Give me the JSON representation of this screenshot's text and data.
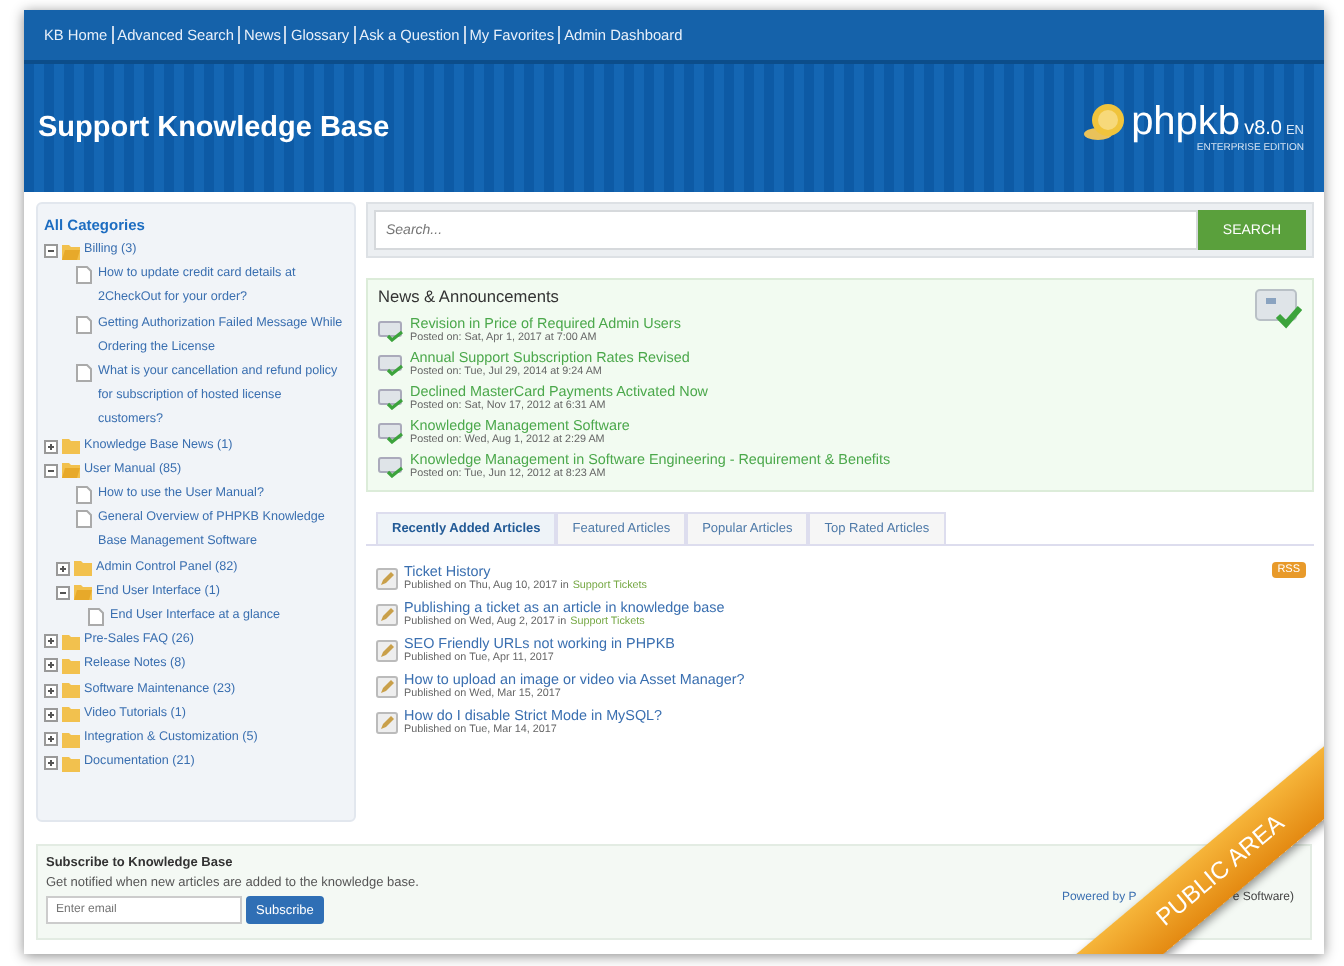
{
  "top_nav": [
    "KB Home",
    "Advanced Search",
    "News",
    "Glossary",
    "Ask a Question",
    "My Favorites",
    "Admin Dashboard"
  ],
  "header": {
    "title": "Support Knowledge Base",
    "logo": "phpkb",
    "version": "v8.0",
    "lang": "EN",
    "edition": "ENTERPRISE EDITION"
  },
  "sidebar": {
    "heading": "All Categories",
    "tree": [
      {
        "kind": "folder",
        "label": "Billing (3)",
        "expanded": true,
        "children": [
          {
            "kind": "article",
            "label": "How to update credit card details at 2CheckOut for your order?"
          },
          {
            "kind": "article",
            "label": "Getting Authorization Failed Message While Ordering the License"
          },
          {
            "kind": "article",
            "label": "What is your cancellation and refund policy for subscription of hosted license customers?"
          }
        ]
      },
      {
        "kind": "folder",
        "label": "Knowledge Base News (1)",
        "expanded": false
      },
      {
        "kind": "folder",
        "label": "User Manual (85)",
        "expanded": true,
        "children": [
          {
            "kind": "article",
            "label": "How to use the User Manual?"
          },
          {
            "kind": "article",
            "label": "General Overview of PHPKB Knowledge Base Management Software"
          },
          {
            "kind": "folder",
            "label": "Admin Control Panel (82)",
            "expanded": false
          },
          {
            "kind": "folder",
            "label": "End User Interface (1)",
            "expanded": true,
            "children": [
              {
                "kind": "article",
                "label": "End User Interface at a glance"
              }
            ]
          }
        ]
      },
      {
        "kind": "folder",
        "label": "Pre-Sales FAQ (26)",
        "expanded": false
      },
      {
        "kind": "folder",
        "label": "Release Notes (8)",
        "expanded": false
      },
      {
        "kind": "folder",
        "label": "Software Maintenance (23)",
        "expanded": false
      },
      {
        "kind": "folder",
        "label": "Video Tutorials (1)",
        "expanded": false
      },
      {
        "kind": "folder",
        "label": "Integration & Customization (5)",
        "expanded": false
      },
      {
        "kind": "folder",
        "label": "Documentation (21)",
        "expanded": false
      }
    ]
  },
  "search": {
    "placeholder": "Search...",
    "button": "SEARCH"
  },
  "news": {
    "heading": "News & Announcements",
    "items": [
      {
        "title": "Revision in Price of Required Admin Users",
        "posted": "Posted on: Sat, Apr 1, 2017 at 7:00 AM"
      },
      {
        "title": "Annual Support Subscription Rates Revised",
        "posted": "Posted on: Tue, Jul 29, 2014 at 9:24 AM"
      },
      {
        "title": "Declined MasterCard Payments Activated Now",
        "posted": "Posted on: Sat, Nov 17, 2012 at 6:31 AM"
      },
      {
        "title": "Knowledge Management Software",
        "posted": "Posted on: Wed, Aug 1, 2012 at 2:29 AM"
      },
      {
        "title": "Knowledge Management in Software Engineering - Requirement & Benefits",
        "posted": "Posted on: Tue, Jun 12, 2012 at 8:23 AM"
      }
    ]
  },
  "tabs": [
    {
      "label": "Recently Added Articles",
      "selected": true
    },
    {
      "label": "Featured Articles",
      "selected": false
    },
    {
      "label": "Popular Articles",
      "selected": false
    },
    {
      "label": "Top Rated Articles",
      "selected": false
    }
  ],
  "rss": "RSS",
  "articles": [
    {
      "title": "Ticket History",
      "published": "Published on Thu, Aug 10, 2017 in",
      "category": "Support Tickets"
    },
    {
      "title": "Publishing a ticket as an article in knowledge base",
      "published": "Published on Wed, Aug 2, 2017 in",
      "category": "Support Tickets"
    },
    {
      "title": "SEO Friendly URLs not working in PHPKB",
      "published": "Published on Tue, Apr 11, 2017"
    },
    {
      "title": "How to upload an image or video via Asset Manager?",
      "published": "Published on Wed, Mar 15, 2017"
    },
    {
      "title": "How do I disable Strict Mode in MySQL?",
      "published": "Published on Tue, Mar 14, 2017"
    }
  ],
  "subscribe": {
    "heading": "Subscribe to Knowledge Base",
    "text": "Get notified when new articles are added to the knowledge base.",
    "placeholder": "Enter email",
    "button": "Subscribe"
  },
  "powered": [
    "Powered by P",
    "e Software)"
  ],
  "ribbon": "PUBLIC AREA"
}
